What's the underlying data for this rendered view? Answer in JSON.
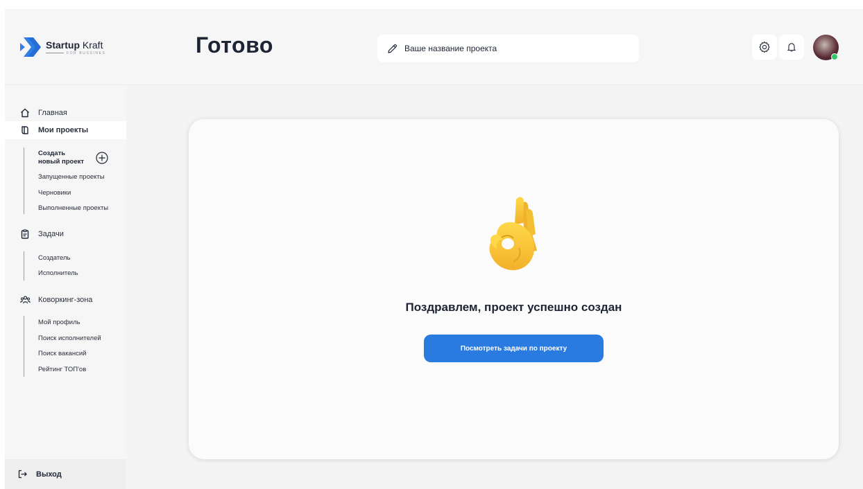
{
  "brand": {
    "name_bold": "Startup",
    "name_light": " Kraft",
    "tagline": "FOR BUSSINES"
  },
  "sidebar": {
    "items": [
      {
        "label": "Главная"
      },
      {
        "label": "Мои проекты"
      },
      {
        "label": "Задачи"
      },
      {
        "label": "Коворкинг-зона"
      }
    ],
    "projects_sub": {
      "create_line1": "Создать",
      "create_line2": "новый проект",
      "items": [
        "Запущенные проекты",
        "Черновики",
        "Выполненные проекты"
      ]
    },
    "tasks_sub": {
      "items": [
        "Создатель",
        "Исполнитель"
      ]
    },
    "coworking_sub": {
      "items": [
        "Мой профиль",
        "Поиск исполнителей",
        "Поиск вакансий",
        "Рейтинг ТОП'ов"
      ]
    },
    "logout": "Выход"
  },
  "header": {
    "title": "Готово",
    "project_name_placeholder": "Ваше название проекта"
  },
  "main": {
    "success_text": "Поздравлем, проект успешно создан",
    "view_tasks_button": "Посмотреть задачи по проекту"
  },
  "colors": {
    "accent": "#2a7be0",
    "online": "#2fc76a",
    "logo_blue": "#2f7fe6"
  }
}
